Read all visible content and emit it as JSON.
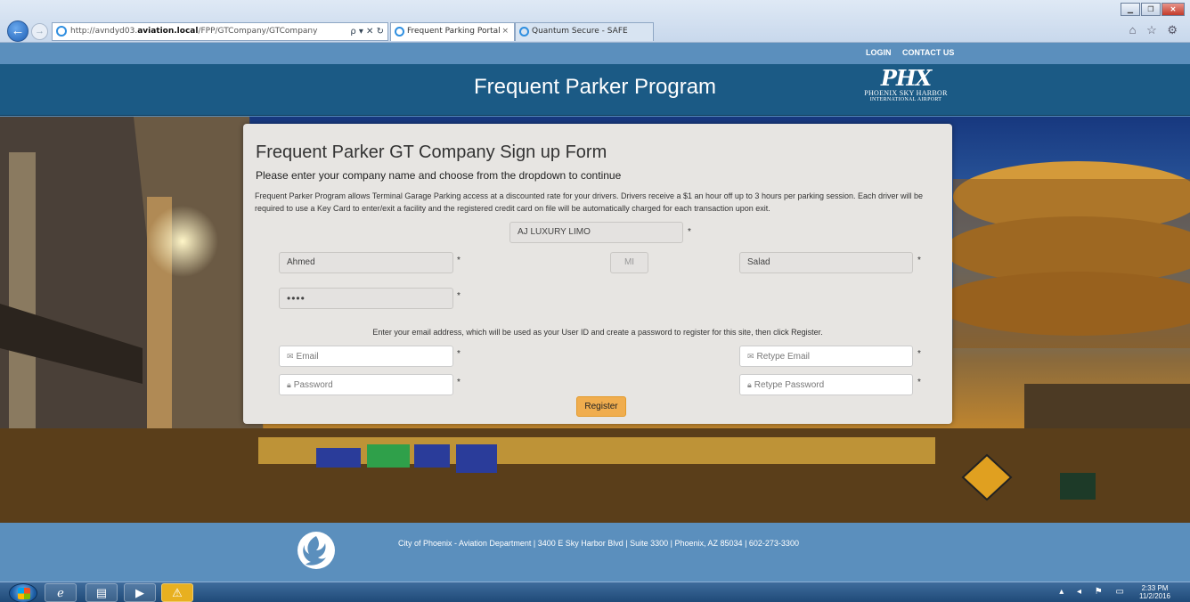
{
  "browser": {
    "url_prefix": "http://avndyd03.",
    "url_domain": "aviation.local",
    "url_path": "/FPP/GTCompany/GTCompany",
    "url_tools": "ρ ▾ ✕ ↻",
    "tabs": [
      {
        "label": "Frequent Parking Portal",
        "close": "×"
      },
      {
        "label": "Quantum Secure - SAFE"
      }
    ],
    "toolbar_icons": "⌂ ☆ ⚙"
  },
  "header": {
    "links": [
      "LOGIN",
      "CONTACT US"
    ],
    "title": "Frequent Parker Program",
    "logo_mark": "PHX",
    "logo_line1": "PHOENIX SKY HARBOR",
    "logo_line2": "INTERNATIONAL AIRPORT"
  },
  "form": {
    "title": "Frequent Parker GT Company Sign up Form",
    "subtitle": "Please enter your company name and choose from the dropdown to continue",
    "description": "Frequent Parker Program allows Terminal Garage Parking access at a discounted rate for your drivers. Drivers receive a $1 an hour off up to 3 hours per parking session. Each driver will be required to use a Key Card to enter/exit a facility and the registered credit card on file will be automatically charged for each transaction upon exit.",
    "company": "AJ LUXURY LIMO",
    "first_name": "Ahmed",
    "middle_initial_placeholder": "MI",
    "last_name": "Salad",
    "masked_value": "••••",
    "required_mark": "*",
    "email_note": "Enter your email address, which will be used as your User ID and create a password to register for this site, then click Register.",
    "email_placeholder": "Email",
    "retype_email_placeholder": "Retype Email",
    "password_placeholder": "Password",
    "retype_password_placeholder": "Retype Password",
    "register_label": "Register"
  },
  "footer": {
    "text": "City of Phoenix - Aviation Department | 3400 E Sky Harbor Blvd | Suite 3300 | Phoenix, AZ 85034 | 602-273-3300"
  },
  "taskbar": {
    "time": "2:33 PM",
    "date": "11/2/2016"
  },
  "colors": {
    "header_bar": "#5b8fbd",
    "banner": "#1b5a85",
    "register_button": "#f0ad4e",
    "card": "#e7e5e2"
  }
}
